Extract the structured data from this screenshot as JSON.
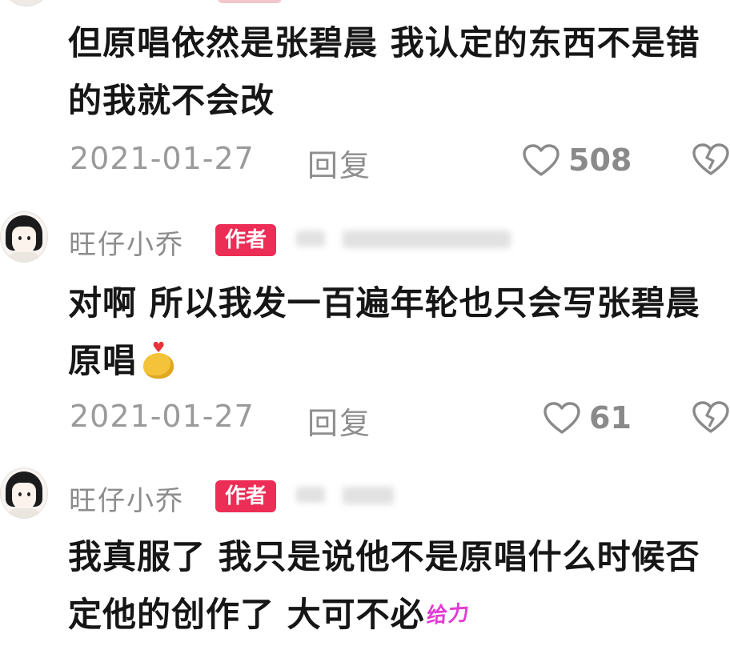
{
  "comments": [
    {
      "username": "",
      "author_badge": "",
      "text": "但原唱依然是张碧晨 我认定的东西不是错的我就不会改",
      "date": "2021-01-27",
      "reply_label": "回复",
      "likes": "508"
    },
    {
      "username": "旺仔小乔",
      "author_badge": "作者",
      "text": "对啊 所以我发一百遍年轮也只会写张碧晨原唱",
      "date": "2021-01-27",
      "reply_label": "回复",
      "likes": "61"
    },
    {
      "username": "旺仔小乔",
      "author_badge": "作者",
      "text": "我真服了 我只是说他不是原唱什么时候否定他的创作了 大可不必",
      "sticker_text": "给力"
    }
  ],
  "icons": {
    "like": "heart-outline-icon",
    "dislike": "broken-heart-icon",
    "emoji": "heart-hands-emoji"
  },
  "colors": {
    "author_badge_bg": "#ec2d56",
    "meta_text": "#9a9a9a",
    "body_text": "#161616",
    "sticker": "#e23ad5"
  }
}
